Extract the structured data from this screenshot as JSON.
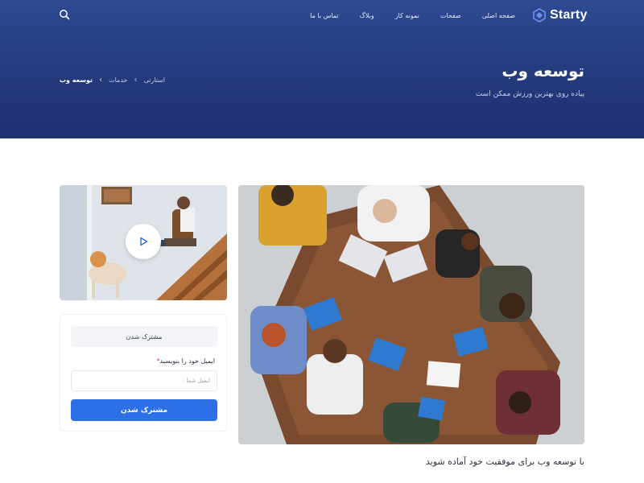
{
  "brand": {
    "name": "Starty",
    "accent": "#2f6fe6",
    "header_bg": "#253a7b"
  },
  "nav": {
    "items": [
      {
        "label": "صفحه اصلی"
      },
      {
        "label": "صفحات"
      },
      {
        "label": "نمونه کار"
      },
      {
        "label": "وبلاگ"
      },
      {
        "label": "تماس با ما"
      }
    ],
    "search_icon": "search-icon"
  },
  "hero": {
    "title": "توسعه وب",
    "subtitle": "پیاده روی بهترین ورزش ممکن است",
    "breadcrumb": [
      "استارتی",
      "خدمات",
      "توسعه وب"
    ]
  },
  "video": {
    "play_icon": "play-icon"
  },
  "subscribe": {
    "heading": "مشترک شدن",
    "email_label": "ایمیل خود را بنویسید",
    "required_mark": "*",
    "email_placeholder": "ایمیل شما :",
    "email_value": "",
    "button_label": "مشترک شدن"
  },
  "content": {
    "lead_text": "با توسعه وب برای موفقیت خود آماده شوید"
  }
}
